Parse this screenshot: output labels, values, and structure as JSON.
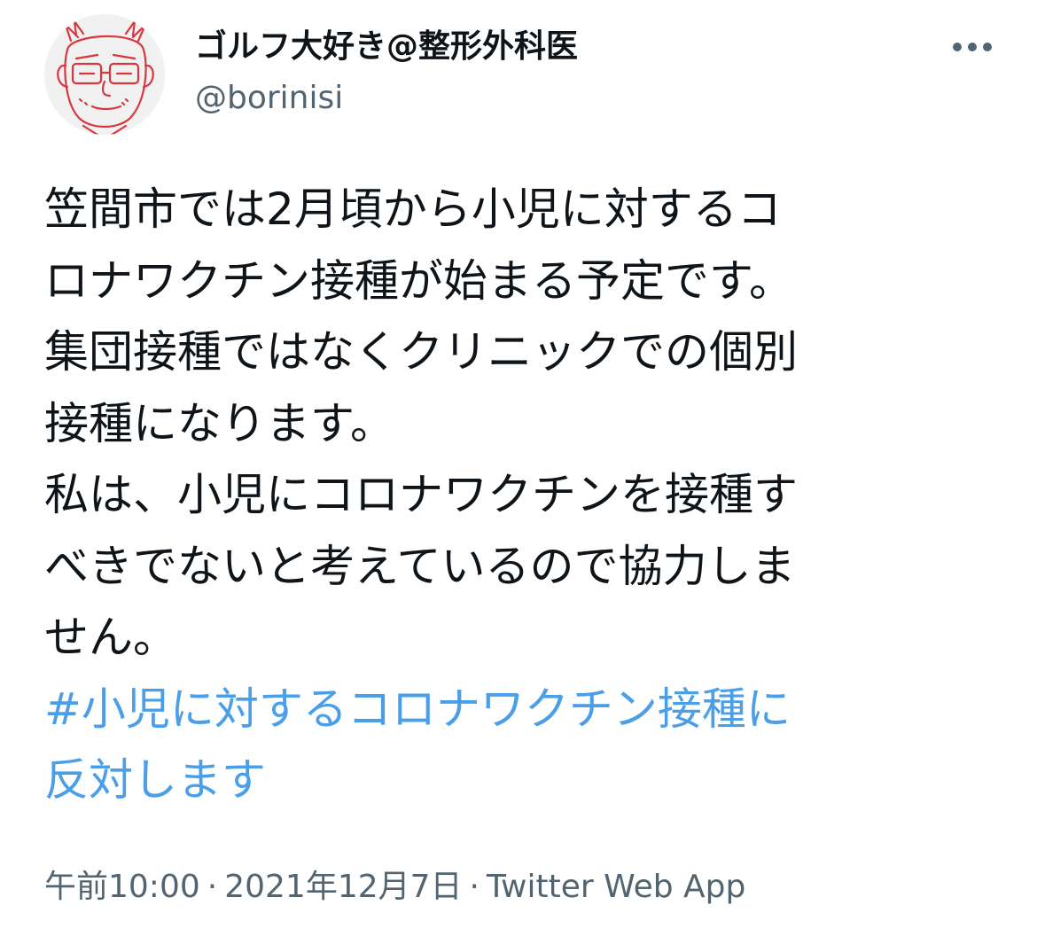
{
  "author": {
    "display_name": "ゴルフ大好き@整形外科医",
    "handle": "@borinisi"
  },
  "icons": {
    "avatar": "doctor-sketch-avatar",
    "more": "more-horizontal-icon"
  },
  "tweet": {
    "text_lines": [
      "笠間市では2月頃から小児に対するコ",
      "ロナワクチン接種が始まる予定です。",
      "集団接種ではなくクリニックでの個別",
      "接種になります。",
      "私は、小児にコロナワクチンを接種す",
      "べきでないと考えているので協力しま",
      "せん。"
    ],
    "hashtag_lines": [
      "#小児に対するコロナワクチン接種に",
      "反対します"
    ]
  },
  "meta": {
    "time": "午前10:00",
    "separator": "·",
    "date": "2021年12月7日",
    "source": "Twitter Web App"
  },
  "colors": {
    "text": "#0f1419",
    "secondary": "#536471",
    "link": "#4a9fe8",
    "avatar_ink": "#d9363e"
  }
}
